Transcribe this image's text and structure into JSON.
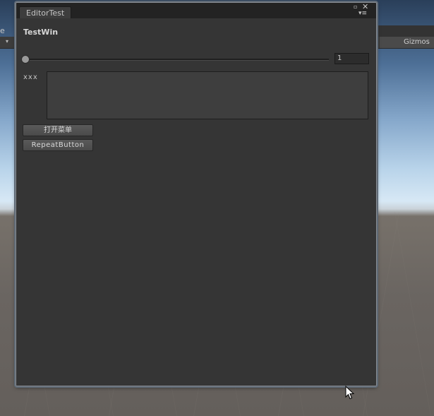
{
  "scene": {
    "left_fragment": "e",
    "gizmos_label": "Gizmos"
  },
  "window": {
    "tab_title": "EditorTest",
    "content": {
      "title": "TestWin",
      "slider": {
        "value": "1",
        "fraction": 0.0
      },
      "text_field": {
        "label": "xxx",
        "value": ""
      },
      "buttons": {
        "open_menu_label": "打开菜单",
        "repeat_button_label": "RepeatButton"
      }
    }
  },
  "colors": {
    "window_bg": "#353535",
    "tab_bar_bg": "#232323",
    "button_bg": "#545454"
  },
  "icons": {
    "maximize": "maximize-icon",
    "close": "close-icon",
    "menu": "menu-icon",
    "cursor": "cursor-icon"
  }
}
